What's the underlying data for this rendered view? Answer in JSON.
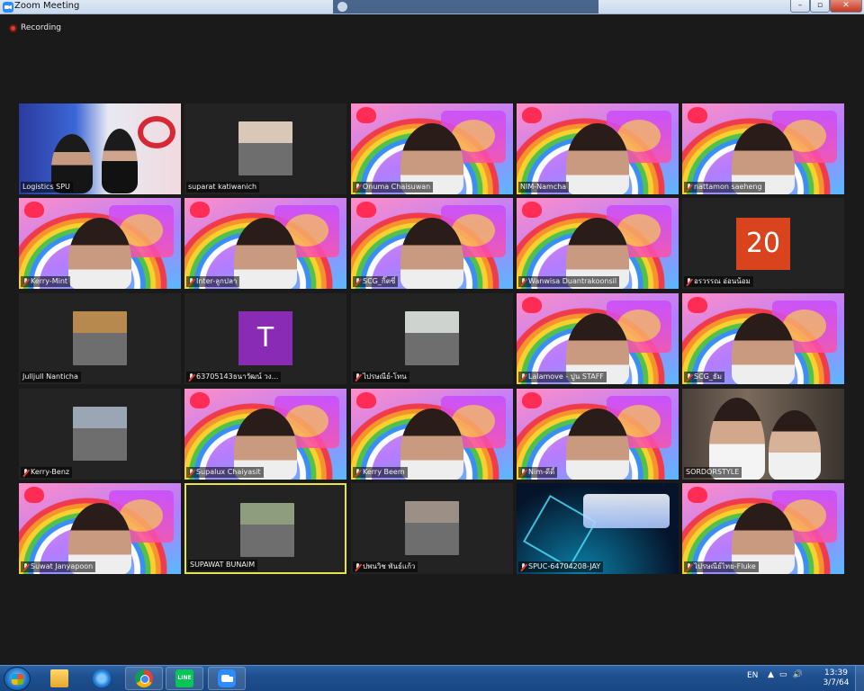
{
  "window": {
    "title": "Zoom Meeting",
    "min": "–",
    "max": "▫",
    "close": "✕"
  },
  "recording": {
    "label": "Recording"
  },
  "participants": [
    {
      "name": "Logistics SPU",
      "muted": false,
      "bg": "stage"
    },
    {
      "name": "suparat katiwanich",
      "muted": false,
      "bg": "thumb",
      "thumb_color": "#d9c8b8"
    },
    {
      "name": "Onuma Chaisuwan",
      "muted": true,
      "bg": "rainbow"
    },
    {
      "name": "NIM-Namcha",
      "muted": false,
      "bg": "rainbow"
    },
    {
      "name": "nattamon saeheng",
      "muted": true,
      "bg": "rainbow"
    },
    {
      "name": "Kerry-Mint",
      "muted": true,
      "bg": "rainbow"
    },
    {
      "name": "Inter-ลูกปลา",
      "muted": true,
      "bg": "rainbow"
    },
    {
      "name": "SCG_กิ๊ตซี่",
      "muted": true,
      "bg": "rainbow"
    },
    {
      "name": "Wanwisa Duantrakoonsil",
      "muted": true,
      "bg": "rainbow"
    },
    {
      "name": "อรวรรณ อ่อนน้อม",
      "muted": true,
      "bg": "number",
      "avatar_text": "20"
    },
    {
      "name": "Julljull Nanticha",
      "muted": false,
      "bg": "thumb",
      "thumb_color": "#b8894f"
    },
    {
      "name": "63705143ธนาวัฒน์ วง...",
      "muted": true,
      "bg": "letter",
      "avatar_text": "T"
    },
    {
      "name": "ไปรษณีย์-โทน",
      "muted": true,
      "bg": "thumb",
      "thumb_color": "#cfd3cf"
    },
    {
      "name": "Lalamove - ปูน STAFF",
      "muted": true,
      "bg": "rainbow"
    },
    {
      "name": "SCG_ธัม",
      "muted": true,
      "bg": "rainbow"
    },
    {
      "name": "Kerry-Benz",
      "muted": true,
      "bg": "thumb",
      "thumb_color": "#9aa6b4"
    },
    {
      "name": "Supalux Chaiyasit",
      "muted": true,
      "bg": "rainbow"
    },
    {
      "name": "Kerry Beem",
      "muted": true,
      "bg": "rainbow"
    },
    {
      "name": "Nim-ดีดี้",
      "muted": true,
      "bg": "rainbow"
    },
    {
      "name": "SORDORSTYLE",
      "muted": false,
      "bg": "room"
    },
    {
      "name": "Suwat Janyapoon",
      "muted": true,
      "bg": "rainbow"
    },
    {
      "name": "SUPAWAT BUNAIM",
      "muted": false,
      "bg": "thumb",
      "thumb_color": "#8e9d7d",
      "active": true
    },
    {
      "name": "ปพนวิช พันธ์แก้ว",
      "muted": true,
      "bg": "thumb",
      "thumb_color": "#9b8f86"
    },
    {
      "name": "SPUC-64704208-JAY",
      "muted": true,
      "bg": "neon"
    },
    {
      "name": "ไปรษณีย์ไทย-Fluke",
      "muted": true,
      "bg": "rainbow"
    }
  ],
  "taskbar": {
    "apps": [
      {
        "name": "folder-icon",
        "running": false
      },
      {
        "name": "ie-icon",
        "running": false
      },
      {
        "name": "chrome-icon",
        "running": true
      },
      {
        "name": "line-icon",
        "running": true,
        "text": "LINE"
      },
      {
        "name": "zoomapp-icon",
        "running": true
      }
    ],
    "language": "EN",
    "tray": {
      "arrow": "▲",
      "network": "▭",
      "volume": "🔊"
    },
    "time": "13:39",
    "date": "3/7/64"
  }
}
